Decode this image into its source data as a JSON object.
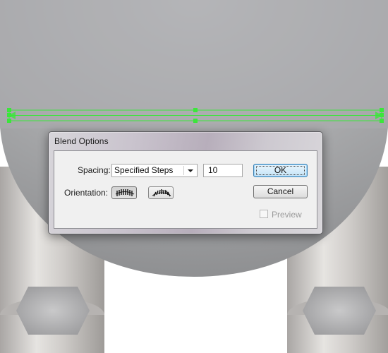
{
  "dialog": {
    "title": "Blend Options",
    "spacing": {
      "label": "Spacing:",
      "selected": "Specified Steps",
      "value": "10"
    },
    "orientation": {
      "label": "Orientation:",
      "options": [
        {
          "icon": "align-to-page-icon",
          "active": true
        },
        {
          "icon": "align-to-path-icon",
          "active": false
        }
      ]
    },
    "buttons": {
      "ok": "OK",
      "cancel": "Cancel"
    },
    "preview": {
      "label": "Preview",
      "checked": false,
      "enabled": false
    }
  },
  "colors": {
    "selection": "#3be63b",
    "artwork_gray": "#a7a8aa",
    "default_button": "#3c7fb1"
  }
}
